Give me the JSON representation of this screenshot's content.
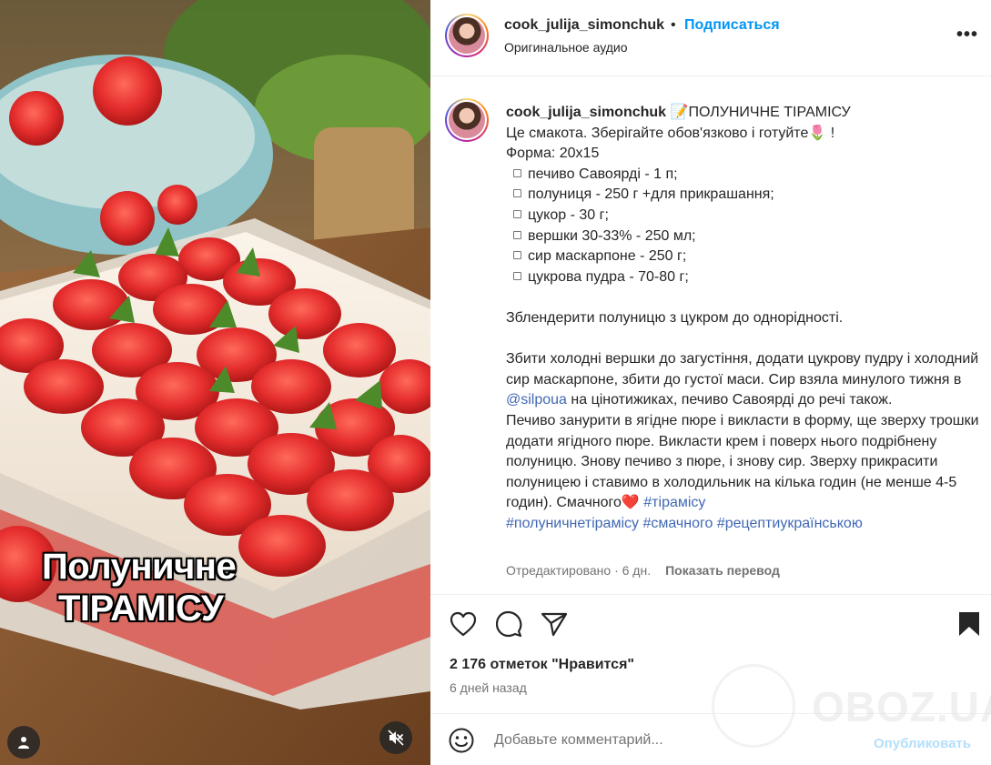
{
  "media": {
    "overlay_line1": "Полуничне",
    "overlay_line2": "ТІРАМІСУ",
    "user_icon": "user-icon",
    "mute_icon": "muted-speaker-icon"
  },
  "header": {
    "username": "cook_julija_simonchuk",
    "separator": "•",
    "follow_label": "Подписаться",
    "audio_label": "Оригинальное аудио",
    "more_label": "•••"
  },
  "caption": {
    "username": "cook_julija_simonchuk",
    "title": "📝ПОЛУНИЧНЕ ТІРАМІСУ",
    "line1": "Це смакота. Зберігайте обов'язково і готуйте🌷 !",
    "form": "Форма: 20х15",
    "ingredients": [
      "печиво Савоярді - 1 п;",
      "полуниця - 250 г +для прикрашання;",
      "цукор - 30 г;",
      "вершки 30-33% - 250 мл;",
      "сир маскарпоне - 250 г;",
      "цукрова пудра - 70-80 г;"
    ],
    "step1": "Зблендерити полуницю з цукром до однорідності.",
    "step2_a": "Збити холодні вершки до загустіння, додати цукрову пудру і холодний сир маскарпоне, збити до густої маси. Сир взяла минулого тижня в ",
    "step2_mention": "@silpoua",
    "step2_b": " на цінотижиках, печиво Савоярді до речі також.",
    "step3": "Печиво занурити в ягідне пюре і викласти в форму, ще зверху трошки додати ягідного пюре. Викласти крем і поверх нього подрібнену полуницю. Знову печиво з пюре, і знову сир. Зверху прикрасити полуницею і ставимо в холодильник на кілька годин (не менше 4-5 годин). Смачного❤️ ",
    "tags": [
      "#тірамісу",
      "#полуничнетірамісу",
      "#смачного",
      "#рецептиукраїнською"
    ],
    "edited": "Отредактировано · 6 дн.",
    "translate": "Показать перевод"
  },
  "actions": {
    "like_icon": "heart-icon",
    "comment_icon": "comment-icon",
    "share_icon": "share-icon",
    "save_icon": "bookmark-icon"
  },
  "likes": "2 176 отметок \"Нравится\"",
  "time": "6 дней назад",
  "comment": {
    "placeholder": "Добавьте комментарий...",
    "publish": "Опубликовать"
  },
  "watermark": "OBOZ.UA",
  "colors": {
    "link": "#4068b4",
    "follow": "#0095f6",
    "publish": "#b2dffc"
  }
}
